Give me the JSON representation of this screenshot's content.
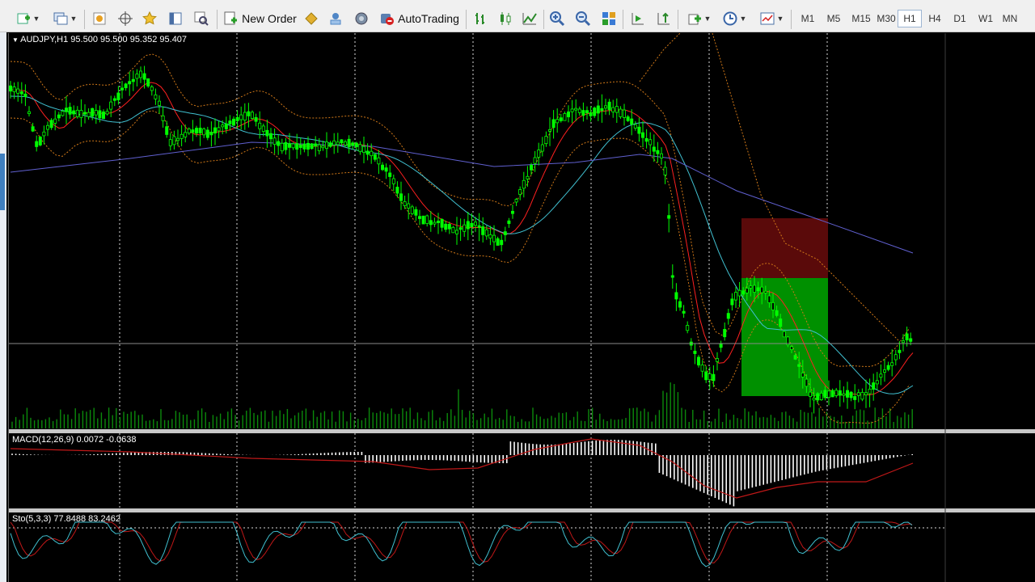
{
  "toolbar": {
    "new_order_label": "New Order",
    "autotrading_label": "AutoTrading",
    "timeframes": [
      "M1",
      "M5",
      "M15",
      "M30",
      "H1",
      "H4",
      "D1",
      "W1",
      "MN"
    ],
    "active_timeframe": "H1"
  },
  "chart": {
    "symbol_header": "AUDJPY,H1  95.500 95.500 95.352 95.407",
    "macd_header": "MACD(12,26,9) 0.0072 -0.0638",
    "stoch_header": "Sto(5,3,3) 77.8488 83.2462",
    "colors": {
      "candle": "#00ff00",
      "fast_ma": "#ff2020",
      "mid_ma": "#40c0d0",
      "slow_ma": "#6060d0",
      "bands": "#d07818",
      "stop_zone": "#5a0a0a",
      "target_zone": "#009000"
    }
  }
}
